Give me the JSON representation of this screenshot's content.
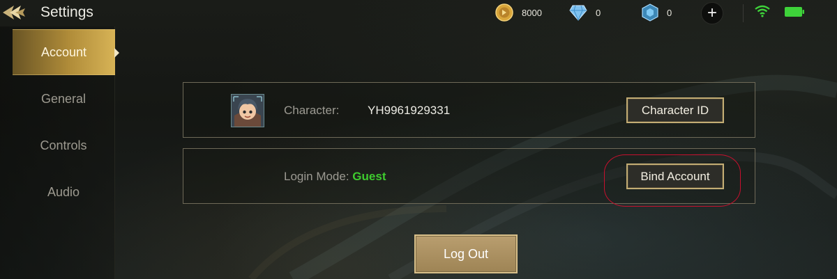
{
  "header": {
    "title": "Settings",
    "gold": "8000",
    "diamonds": "0",
    "gems": "0"
  },
  "sidebar": {
    "items": [
      {
        "label": "Account",
        "active": true
      },
      {
        "label": "General",
        "active": false
      },
      {
        "label": "Controls",
        "active": false
      },
      {
        "label": "Audio",
        "active": false
      }
    ]
  },
  "account": {
    "character_label": "Character:",
    "character_value": "YH9961929331",
    "character_id_button": "Character ID",
    "login_mode_label": "Login Mode:",
    "login_mode_value": "Guest",
    "bind_account_button": "Bind Account",
    "logout_button": "Log Out"
  },
  "colors": {
    "accent_gold": "#c3ad74",
    "login_mode_green": "#3ecb2e",
    "highlight_red": "#c8102e"
  }
}
